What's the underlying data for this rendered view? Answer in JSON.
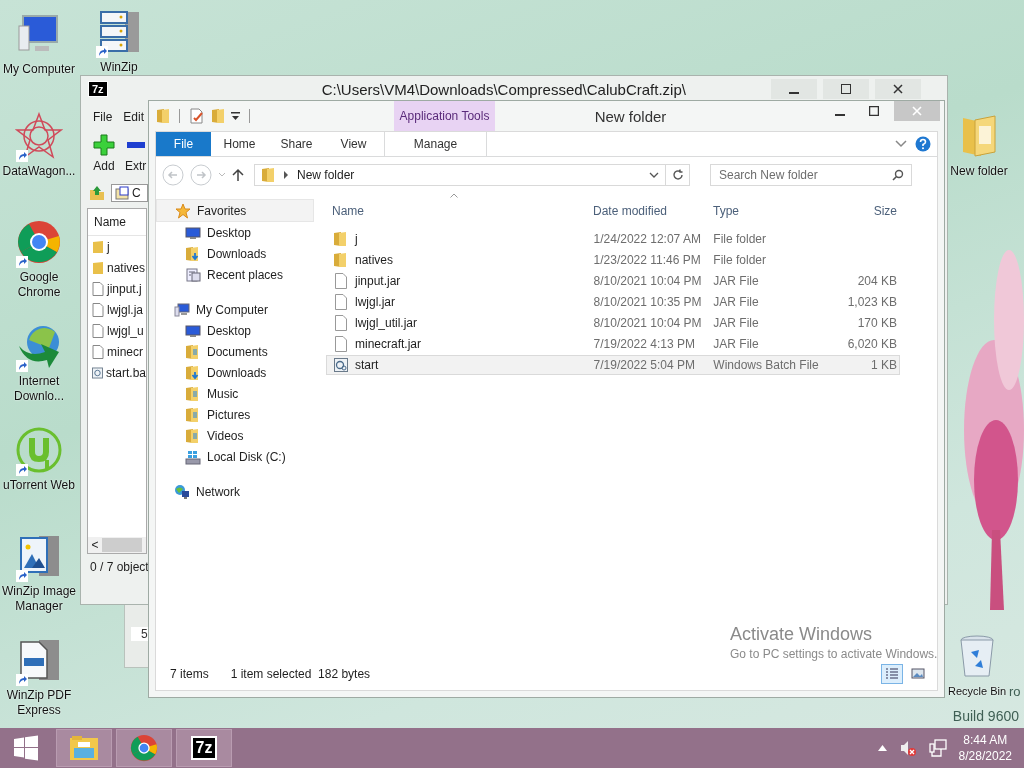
{
  "desktop_icons": [
    {
      "label": "My Computer",
      "kind": "computer",
      "shortcut": false
    },
    {
      "label": "WinZip",
      "kind": "server",
      "shortcut": true
    },
    {
      "label": "DataWagon...",
      "kind": "star",
      "shortcut": true
    },
    {
      "label": "Google Chrome",
      "kind": "chrome",
      "shortcut": true
    },
    {
      "label": "Internet Downlo...",
      "kind": "downloader",
      "shortcut": true
    },
    {
      "label": "uTorrent Web",
      "kind": "torrent",
      "shortcut": true
    },
    {
      "label": "WinZip Image Manager",
      "kind": "image",
      "shortcut": true
    },
    {
      "label": "WinZip PDF Express",
      "kind": "pdf",
      "shortcut": true
    },
    {
      "label": "New folder",
      "kind": "folder",
      "shortcut": false
    },
    {
      "label": "Recycle Bin",
      "kind": "bin",
      "shortcut": false
    }
  ],
  "zip_window": {
    "logo": "7z",
    "title": "C:\\Users\\VM4\\Downloads\\Compressed\\CalubCraft.zip\\",
    "menu": [
      "File",
      "Edit"
    ],
    "toolbar": [
      {
        "label": "Add",
        "kind": "add"
      },
      {
        "label": "Extr",
        "kind": "extract"
      }
    ],
    "path": "C",
    "list_header": "Name",
    "files": [
      {
        "name": "j",
        "kind": "folder"
      },
      {
        "name": "natives",
        "kind": "folder"
      },
      {
        "name": "jinput.j",
        "kind": "file"
      },
      {
        "name": "lwjgl.ja",
        "kind": "file"
      },
      {
        "name": "lwjgl_u",
        "kind": "file"
      },
      {
        "name": "minecr",
        "kind": "file"
      },
      {
        "name": "start.ba",
        "kind": "batch"
      }
    ],
    "scroll_arrow": "<",
    "status": "0 / 7 object"
  },
  "back_window": {
    "text": "5"
  },
  "explorer": {
    "title": "New folder",
    "context_tab": "Application Tools",
    "ribbon_tabs": [
      {
        "label": "File",
        "kind": "file"
      },
      {
        "label": "Home",
        "kind": "tab"
      },
      {
        "label": "Share",
        "kind": "tab"
      },
      {
        "label": "View",
        "kind": "tab"
      },
      {
        "label": "Manage",
        "kind": "context"
      }
    ],
    "address": "New folder",
    "search": {
      "placeholder": "Search New folder"
    },
    "nav": [
      {
        "label": "Favorites",
        "kind": "favorites",
        "highlighted": true,
        "children": [
          {
            "label": "Desktop",
            "kind": "desktop"
          },
          {
            "label": "Downloads",
            "kind": "downloads"
          },
          {
            "label": "Recent places",
            "kind": "recent"
          }
        ]
      },
      {
        "label": "My Computer",
        "kind": "computer",
        "highlighted": false,
        "children": [
          {
            "label": "Desktop",
            "kind": "desktop"
          },
          {
            "label": "Documents",
            "kind": "folder"
          },
          {
            "label": "Downloads",
            "kind": "downloads"
          },
          {
            "label": "Music",
            "kind": "folder"
          },
          {
            "label": "Pictures",
            "kind": "folder"
          },
          {
            "label": "Videos",
            "kind": "folder"
          },
          {
            "label": "Local Disk (C:)",
            "kind": "drive"
          }
        ]
      },
      {
        "label": "Network",
        "kind": "network",
        "highlighted": false
      }
    ],
    "columns": [
      "Name",
      "Date modified",
      "Type",
      "Size"
    ],
    "rows": [
      {
        "name": "j",
        "kind": "folder",
        "date": "1/24/2022 12:07 AM",
        "type": "File folder",
        "size": "",
        "selected": false
      },
      {
        "name": "natives",
        "kind": "folder",
        "date": "1/23/2022 11:46 PM",
        "type": "File folder",
        "size": "",
        "selected": false
      },
      {
        "name": "jinput.jar",
        "kind": "file",
        "date": "8/10/2021 10:04 PM",
        "type": "JAR File",
        "size": "204 KB",
        "selected": false
      },
      {
        "name": "lwjgl.jar",
        "kind": "file",
        "date": "8/10/2021 10:35 PM",
        "type": "JAR File",
        "size": "1,023 KB",
        "selected": false
      },
      {
        "name": "lwjgl_util.jar",
        "kind": "file",
        "date": "8/10/2021 10:04 PM",
        "type": "JAR File",
        "size": "170 KB",
        "selected": false
      },
      {
        "name": "minecraft.jar",
        "kind": "file",
        "date": "7/19/2022 4:13 PM",
        "type": "JAR File",
        "size": "6,020 KB",
        "selected": false
      },
      {
        "name": "start",
        "kind": "batch",
        "date": "7/19/2022 5:04 PM",
        "type": "Windows Batch File",
        "size": "1 KB",
        "selected": true
      }
    ],
    "status": [
      "7 items",
      "1 item selected  182 bytes"
    ],
    "views": [
      {
        "kind": "details",
        "selected": true
      },
      {
        "kind": "tiles",
        "selected": false
      }
    ]
  },
  "watermark": {
    "title": "Activate Windows",
    "text": "Go to PC settings to activate Windows.",
    "edition_fragment": "ro",
    "build": "Build 9600"
  },
  "taskbar": {
    "buttons": [
      {
        "kind": "start"
      },
      {
        "kind": "explorer"
      },
      {
        "kind": "chrome"
      },
      {
        "kind": "sevenzip",
        "label": "7z"
      }
    ],
    "sound_muted": true,
    "time": "8:44 AM",
    "date": "8/28/2022"
  }
}
